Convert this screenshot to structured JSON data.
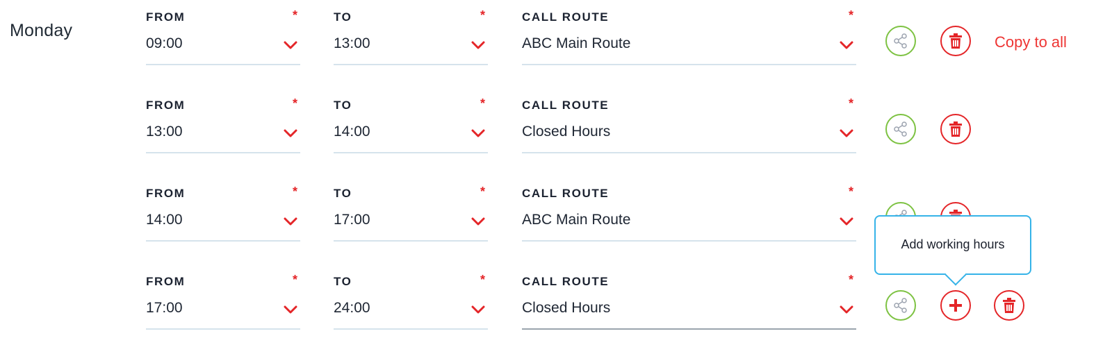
{
  "day": "Monday",
  "labels": {
    "from": "FROM",
    "to": "TO",
    "route": "CALL ROUTE",
    "required": "*"
  },
  "rows": [
    {
      "from": "09:00",
      "to": "13:00",
      "route": "ABC Main Route"
    },
    {
      "from": "13:00",
      "to": "14:00",
      "route": "Closed Hours"
    },
    {
      "from": "14:00",
      "to": "17:00",
      "route": "ABC Main Route"
    },
    {
      "from": "17:00",
      "to": "24:00",
      "route": "Closed Hours"
    }
  ],
  "copy_to_all": "Copy to all",
  "tooltip": "Add working hours",
  "colors": {
    "accent_red": "#e42528",
    "share_green": "#7dc242",
    "tooltip_border": "#35b3e8"
  },
  "icons": {
    "share": "share-icon",
    "delete": "trash-icon",
    "add": "plus-icon",
    "dropdown": "chevron-down-icon"
  }
}
